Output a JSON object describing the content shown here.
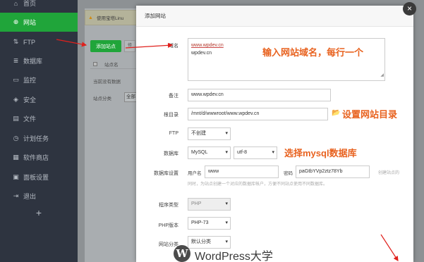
{
  "sidebar": {
    "items": [
      {
        "label": "首页",
        "icon": "home-icon",
        "glyph": "⌂"
      },
      {
        "label": "网站",
        "icon": "globe-icon",
        "glyph": "⊕"
      },
      {
        "label": "FTP",
        "icon": "ftp-icon",
        "glyph": "⇅"
      },
      {
        "label": "数据库",
        "icon": "database-icon",
        "glyph": "≣"
      },
      {
        "label": "监控",
        "icon": "monitor-icon",
        "glyph": "▭"
      },
      {
        "label": "安全",
        "icon": "shield-icon",
        "glyph": "◈"
      },
      {
        "label": "文件",
        "icon": "file-icon",
        "glyph": "▤"
      },
      {
        "label": "计划任务",
        "icon": "clock-icon",
        "glyph": "◷"
      },
      {
        "label": "软件商店",
        "icon": "store-icon",
        "glyph": "▦"
      },
      {
        "label": "面板设置",
        "icon": "gear-icon",
        "glyph": "▣"
      },
      {
        "label": "退出",
        "icon": "logout-icon",
        "glyph": "⇥"
      }
    ],
    "active_index": 1,
    "add_label": "+",
    "colors": {
      "background": "#2e3440",
      "active": "#20a53a"
    }
  },
  "main": {
    "notice_icon": "warning-icon",
    "notice_text": "使用宝塔Linu",
    "add_site_button": "添加站点",
    "secondary_button": "修",
    "table_header": "站点名",
    "empty_text": "当前没有数据",
    "category_label": "站点分类",
    "category_value": "全部"
  },
  "modal": {
    "title": "添加网站",
    "close_label": "×",
    "domain": {
      "label": "域名",
      "line1": "www.wpdev.cn",
      "line2": "wpdev.cn"
    },
    "remark": {
      "label": "备注",
      "value": "www.wpdev.cn"
    },
    "root": {
      "label": "根目录",
      "value": "/mnt/d/wwwroot/www.wpdev.cn",
      "icon": "folder-icon",
      "glyph": "📂"
    },
    "ftp": {
      "label": "FTP",
      "value": "不创建"
    },
    "database": {
      "label": "数据库",
      "type": "MySQL",
      "charset": "utf-8"
    },
    "db_settings": {
      "label": "数据库设置",
      "user_label": "用户名",
      "user_value": "www",
      "pass_label": "密码",
      "pass_value": "paGtbYVp2ztz78Yb",
      "hint_right": "创建站点的",
      "hint_line2": "同时，为站点创建一个对应的数据库帐户，方便不同站点使用不同数据库。"
    },
    "program_type": {
      "label": "程序类型",
      "value": "PHP"
    },
    "php_version": {
      "label": "PHP版本",
      "value": "PHP-73"
    },
    "site_category": {
      "label": "网站分类",
      "value": "默认分类"
    }
  },
  "annotations": {
    "domain_hint": "输入网站域名，每行一个",
    "root_hint": "设置网站目录",
    "db_hint": "选择mysql数据库",
    "color": "#e8621f"
  },
  "watermark": {
    "logo": "W",
    "text": "WordPress大学"
  }
}
